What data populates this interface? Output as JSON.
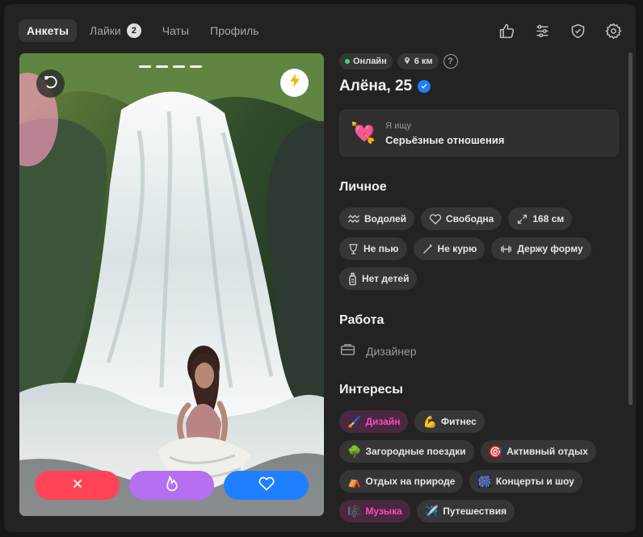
{
  "tabs": [
    {
      "label": "Анкеты",
      "active": true
    },
    {
      "label": "Лайки",
      "count": "2",
      "active": false
    },
    {
      "label": "Чаты",
      "active": false
    },
    {
      "label": "Профиль",
      "active": false
    }
  ],
  "top_icons": [
    "thumb-up-icon",
    "filters-icon",
    "shield-icon",
    "settings-icon"
  ],
  "profile": {
    "online": "Онлайн",
    "distance": "6 км",
    "help": "?",
    "name": "Алёна, 25",
    "seeking": {
      "emoji": "💘",
      "label": "Я ищу",
      "value": "Серьёзные отношения"
    }
  },
  "personal": {
    "title": "Личное",
    "items": [
      {
        "label": "Водолей",
        "icon": "aquarius-icon"
      },
      {
        "label": "Свободна",
        "icon": "heart-outline-icon"
      },
      {
        "label": "168 см",
        "icon": "height-icon"
      },
      {
        "label": "Не пью",
        "icon": "glass-icon"
      },
      {
        "label": "Не курю",
        "icon": "no-smoking-icon"
      },
      {
        "label": "Держу форму",
        "icon": "dumbbell-icon"
      },
      {
        "label": "Нет детей",
        "icon": "baby-bottle-icon"
      }
    ]
  },
  "work": {
    "title": "Работа",
    "value": "Дизайнер",
    "icon": "briefcase-icon"
  },
  "interests": {
    "title": "Интересы",
    "items": [
      {
        "label": "Дизайн",
        "emoji": "🖌️",
        "highlight": true
      },
      {
        "label": "Фитнес",
        "emoji": "💪",
        "highlight": false
      },
      {
        "label": "Загородные поездки",
        "emoji": "🌳",
        "highlight": false
      },
      {
        "label": "Активный отдых",
        "emoji": "🎯",
        "highlight": false
      },
      {
        "label": "Отдых на природе",
        "emoji": "⛺",
        "highlight": false
      },
      {
        "label": "Концерты и шоу",
        "emoji": "🎆",
        "highlight": false
      },
      {
        "label": "Музыка",
        "emoji": "🎼",
        "highlight": true
      },
      {
        "label": "Путешествия",
        "emoji": "✈️",
        "highlight": false
      }
    ]
  },
  "photo": {
    "slides": 4,
    "current": 1
  },
  "colors": {
    "background": "#232323",
    "dislike": "#ff4458",
    "superlike": "#b66ff0",
    "like": "#1e80ff",
    "highlight": "#ff49c6",
    "online": "#48d36a"
  }
}
